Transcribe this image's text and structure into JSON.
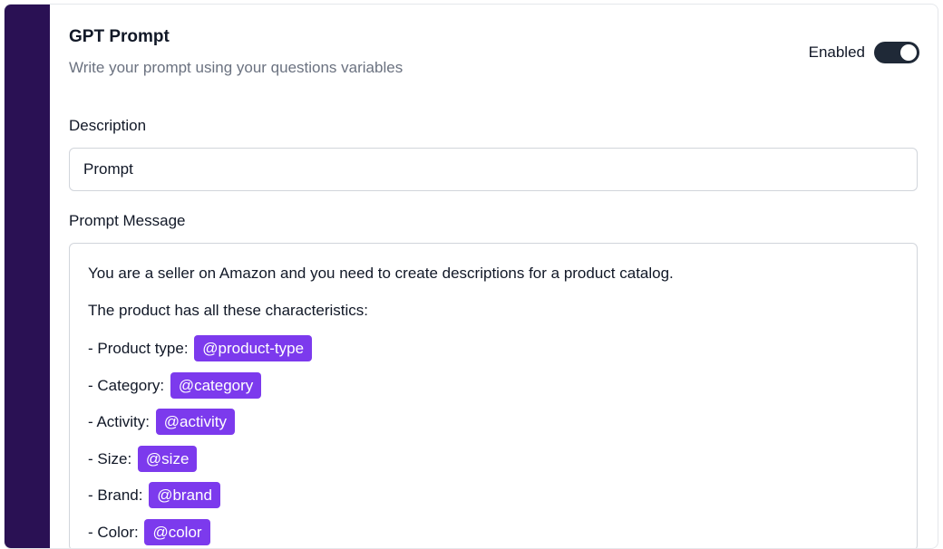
{
  "header": {
    "title": "GPT Prompt",
    "subtitle": "Write your prompt using your questions variables"
  },
  "toggle": {
    "label": "Enabled",
    "state": "on",
    "color": "#1f2937"
  },
  "description": {
    "label": "Description",
    "value": "Prompt"
  },
  "prompt": {
    "label": "Prompt Message",
    "lines": [
      {
        "text": "You are a seller on Amazon and you need to create descriptions for a product catalog.",
        "tag": ""
      },
      {
        "text": "The product has all these characteristics:",
        "tag": ""
      },
      {
        "text": "- Product type:",
        "tag": "@product-type"
      },
      {
        "text": "- Category:",
        "tag": "@category"
      },
      {
        "text": "- Activity:",
        "tag": "@activity"
      },
      {
        "text": "- Size:",
        "tag": "@size"
      },
      {
        "text": "- Brand:",
        "tag": "@brand"
      },
      {
        "text": "- Color:",
        "tag": "@color"
      }
    ]
  },
  "colors": {
    "sidebar": "#2a1154",
    "tag": "#7c3aed"
  }
}
